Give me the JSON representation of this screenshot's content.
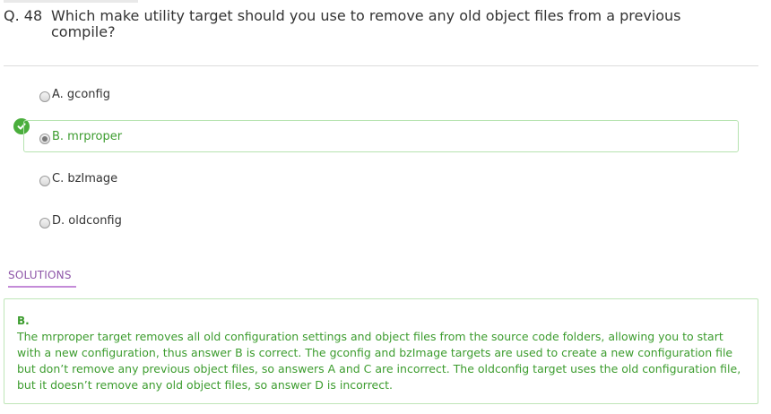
{
  "question": {
    "number": "Q. 48",
    "text": "Which make utility target should you use to remove any old object files from a previous compile?"
  },
  "options": [
    {
      "label": "A. gconfig",
      "selected": false
    },
    {
      "label": "B. mrproper",
      "selected": true
    },
    {
      "label": "C. bzImage",
      "selected": false
    },
    {
      "label": "D. oldconfig",
      "selected": false
    }
  ],
  "solutions": {
    "tab_label": "SOLUTIONS",
    "answer": "B.",
    "explanation": "The mrproper target removes all old configuration settings and object files from the source code folders, allowing you to start with a new configuration, thus answer B is correct. The gconfig and bzImage targets are used to create a new configuration file but don’t remove any previous object files, so answers A and C are incorrect. The oldconfig target uses the old configuration file, but it doesn’t remove any old object files, so answer D is incorrect."
  },
  "icons": {
    "correct": "check-circle-icon"
  },
  "colors": {
    "correct_green": "#3c9c2e",
    "badge_green": "#4aae3c",
    "solutions_purple": "#8e56a8"
  }
}
